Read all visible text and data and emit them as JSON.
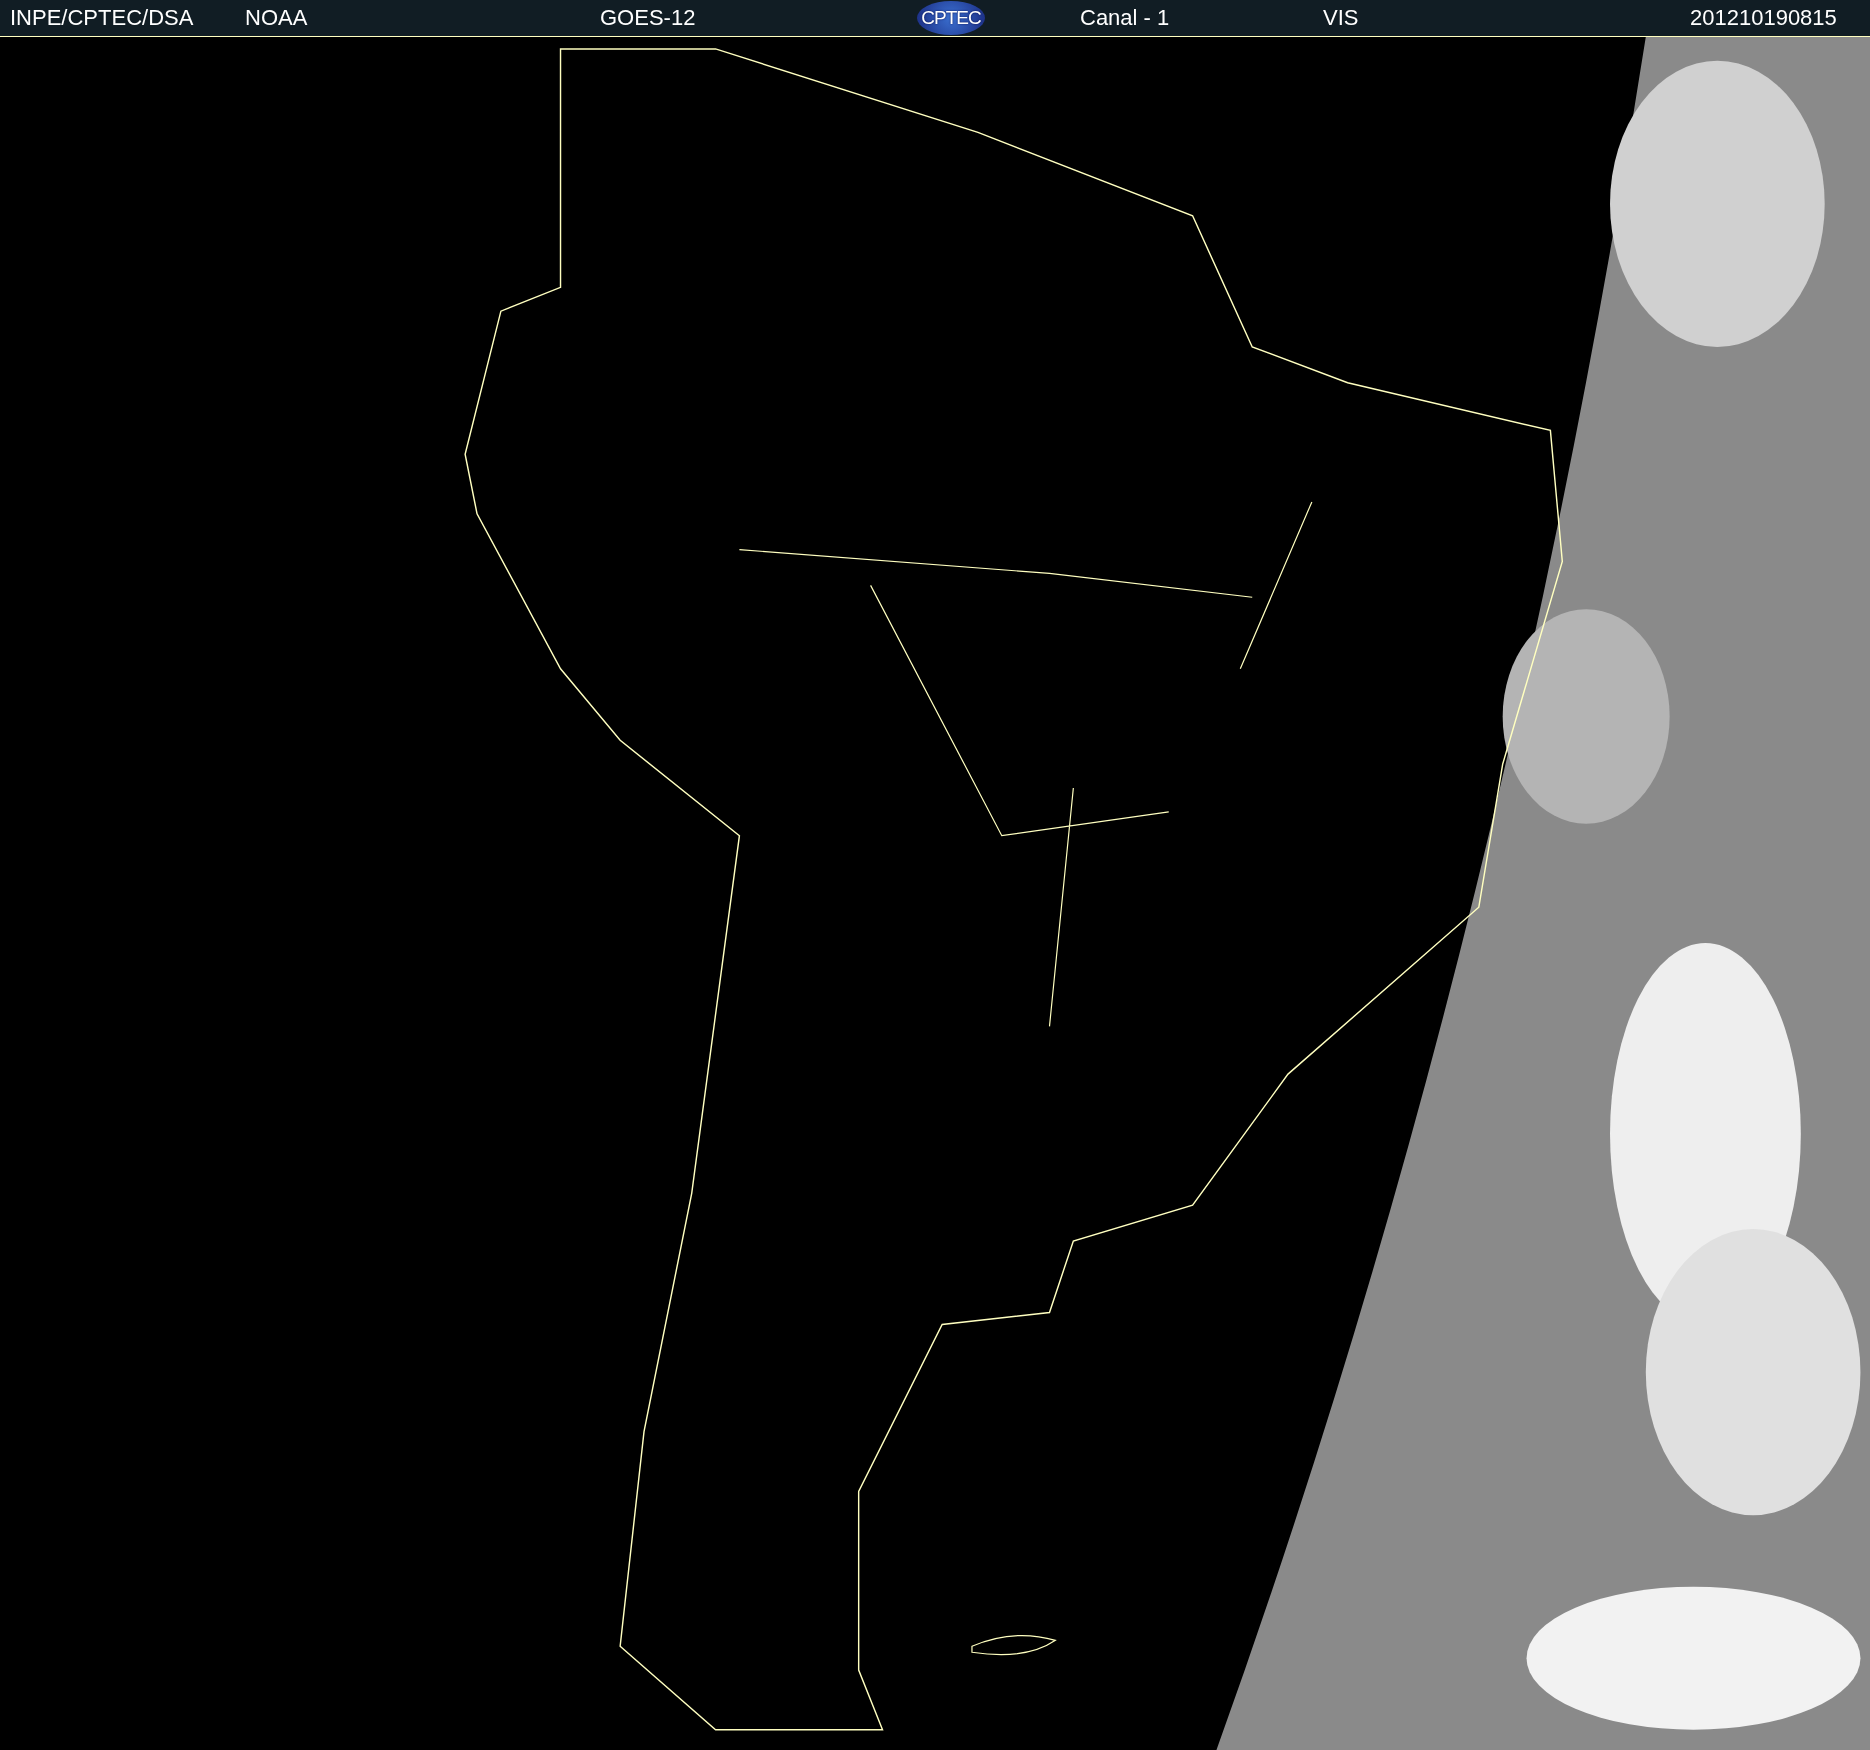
{
  "header": {
    "items": [
      {
        "kind": "text",
        "text": "INPE/CPTEC/DSA"
      },
      {
        "kind": "text",
        "text": "NOAA"
      },
      {
        "kind": "text",
        "text": "GOES-12"
      },
      {
        "kind": "logo",
        "text": "CPTEC"
      },
      {
        "kind": "text",
        "text": "Canal - 1"
      },
      {
        "kind": "text",
        "text": "VIS"
      },
      {
        "kind": "text",
        "text": "201210190815"
      }
    ]
  }
}
